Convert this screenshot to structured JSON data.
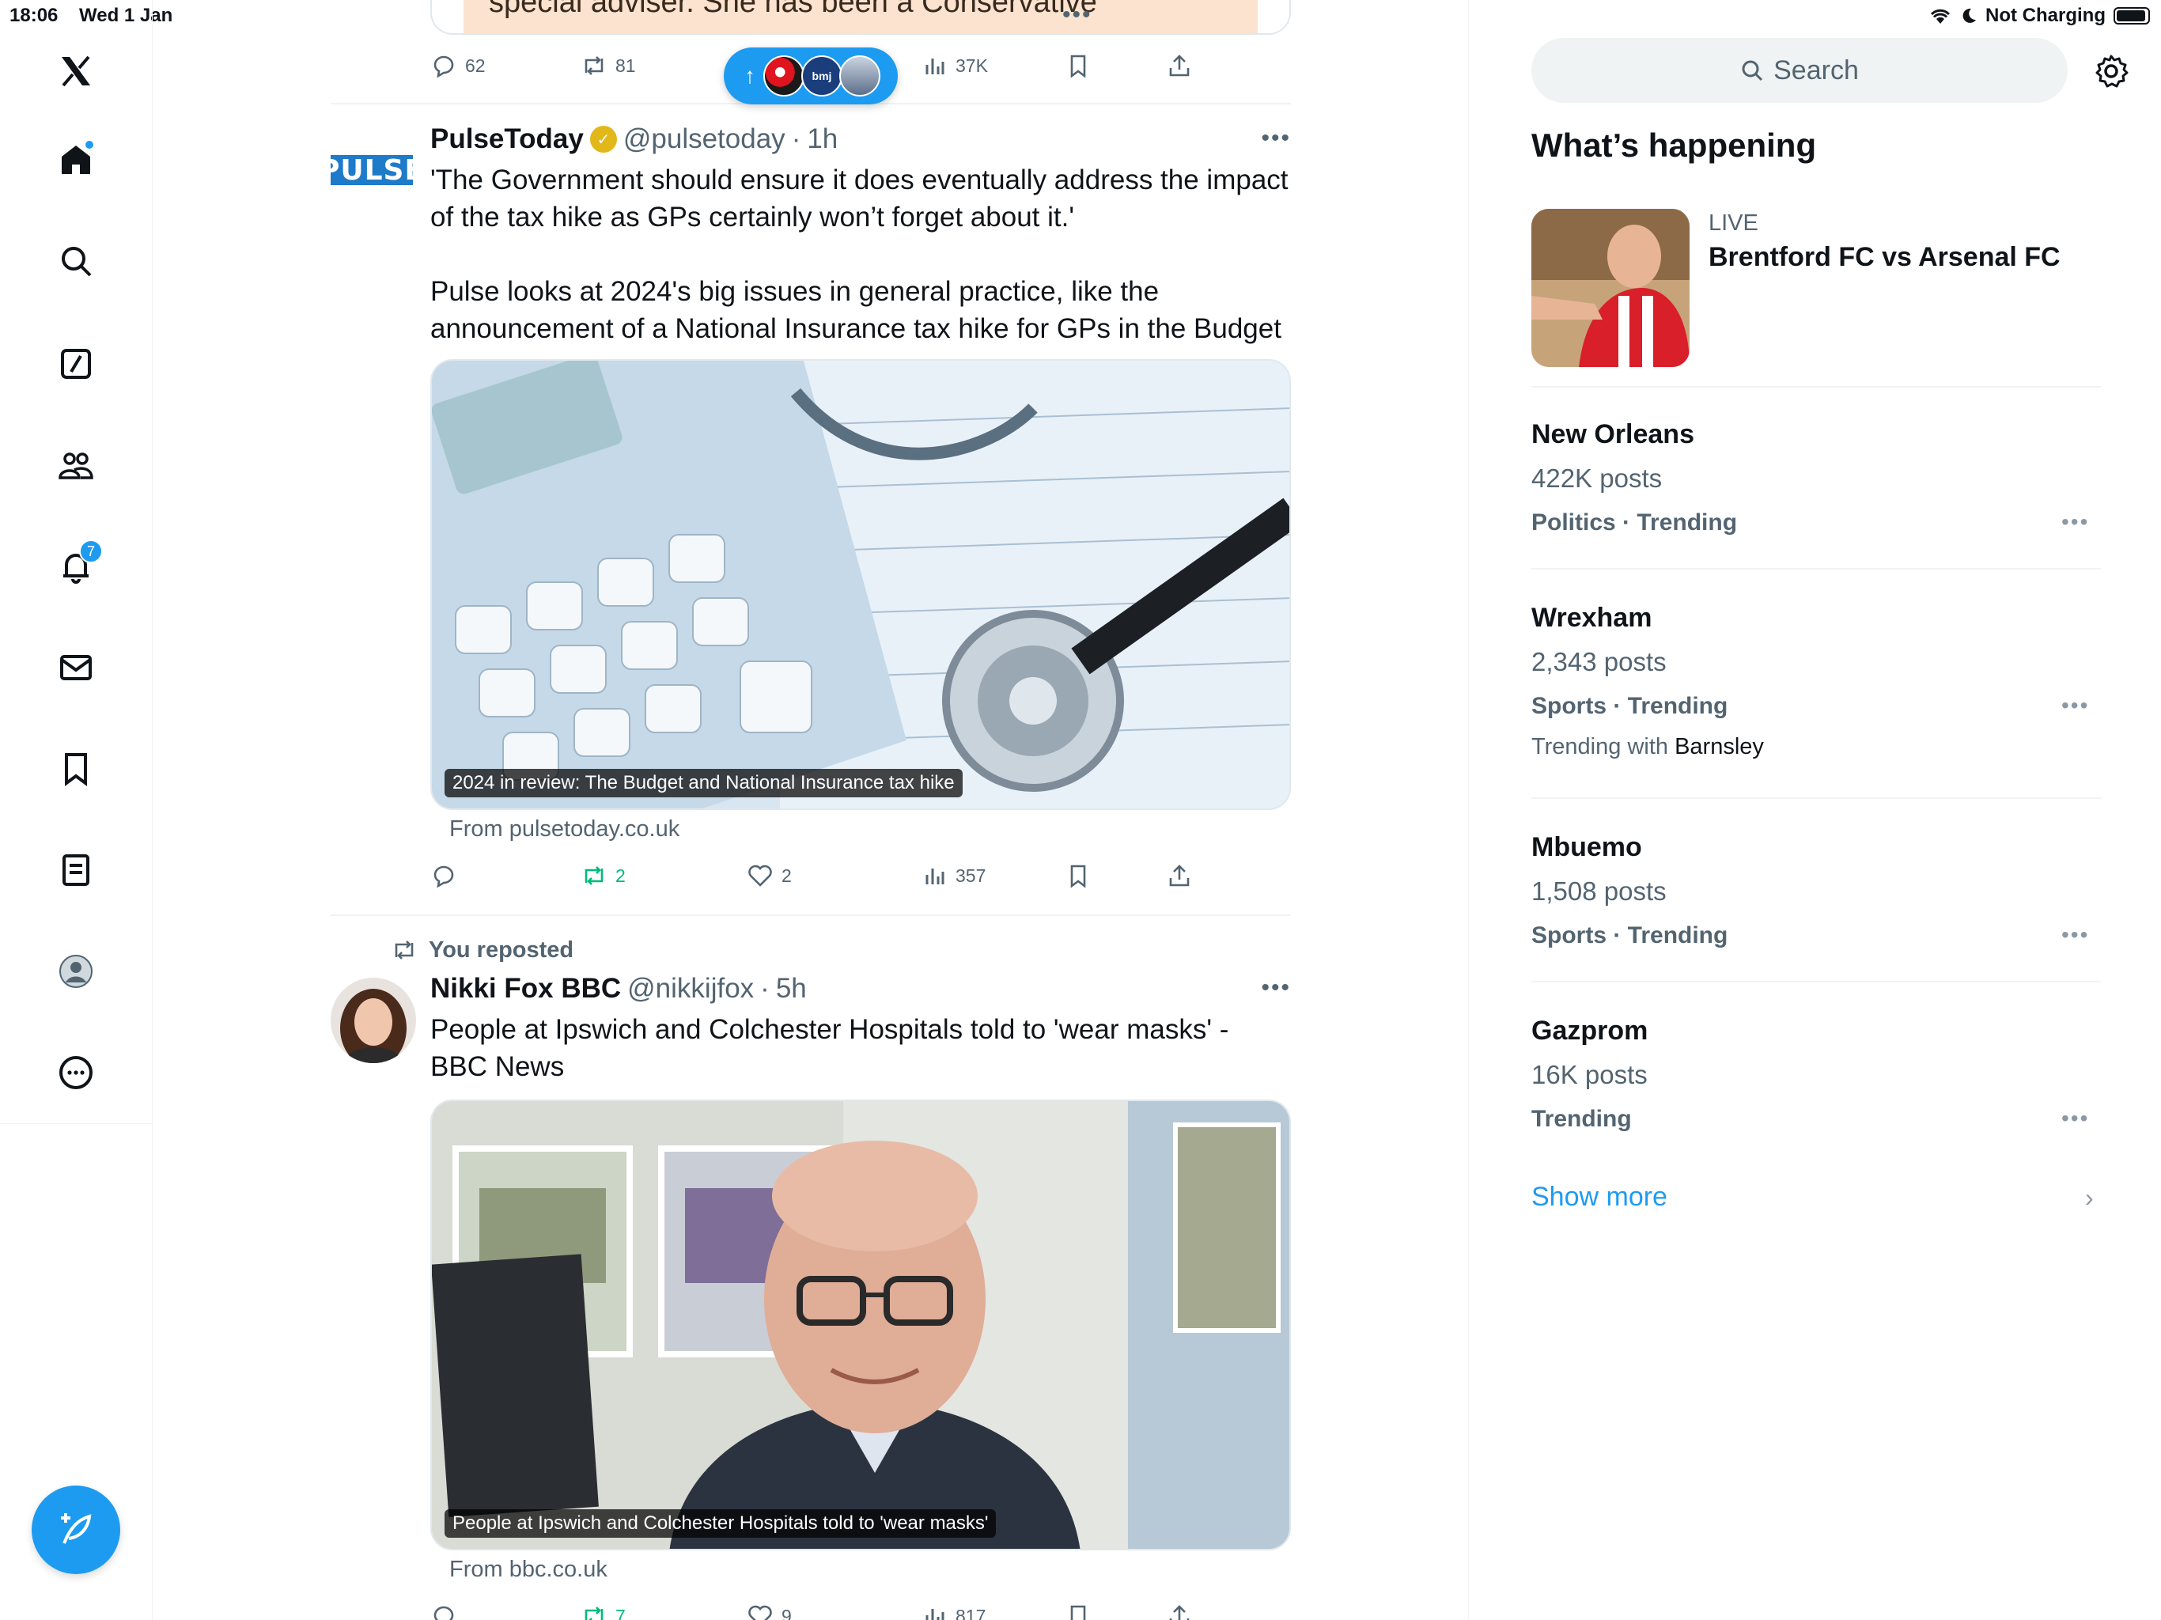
{
  "status": {
    "time": "18:06",
    "date": "Wed 1 Jan",
    "charging": "Not Charging"
  },
  "nav": {
    "items": [
      "home",
      "explore",
      "grok",
      "communities",
      "notifications",
      "messages",
      "bookmarks",
      "lists",
      "profile",
      "more"
    ],
    "notification_count": "7"
  },
  "prev_tweet": {
    "card_text": "special adviser. She has been a Conservative",
    "actions": {
      "reply": "62",
      "repost": "81",
      "views": "37K"
    }
  },
  "new_posts_pill": {
    "label": "bmj"
  },
  "tweet1": {
    "name": "PulseToday",
    "handle": "@pulsetoday",
    "time": "1h",
    "logo_text": "PULSE",
    "text": "'The Government should ensure it does eventually address the impact of the tax hike as GPs certainly won’t forget about it.'\n\nPulse looks at 2024's big issues in general practice, like the announcement of a National Insurance tax hike for GPs in the Budget",
    "media_caption": "2024 in review: The Budget and National Insurance tax hike",
    "from": "From pulsetoday.co.uk",
    "actions": {
      "reply": "",
      "repost": "2",
      "like": "2",
      "views": "357"
    }
  },
  "tweet2": {
    "repost_label": "You reposted",
    "name": "Nikki Fox BBC",
    "handle": "@nikkijfox",
    "time": "5h",
    "text": "People at Ipswich and Colchester Hospitals told to 'wear masks' - BBC News",
    "media_caption": "People at Ipswich and Colchester Hospitals told to 'wear masks'",
    "from": "From bbc.co.uk",
    "actions": {
      "reply": "",
      "repost": "7",
      "like": "9",
      "views": "817"
    }
  },
  "right": {
    "search_placeholder": "Search",
    "section_title": "What’s happening",
    "live": {
      "label": "LIVE",
      "title": "Brentford FC vs Arsenal FC"
    },
    "trends": [
      {
        "name": "New Orleans",
        "posts": "422K posts",
        "category": "Politics · Trending",
        "with_label": "",
        "with_value": ""
      },
      {
        "name": "Wrexham",
        "posts": "2,343 posts",
        "category": "Sports · Trending",
        "with_label": "Trending with",
        "with_value": "Barnsley"
      },
      {
        "name": "Mbuemo",
        "posts": "1,508 posts",
        "category": "Sports · Trending",
        "with_label": "",
        "with_value": ""
      },
      {
        "name": "Gazprom",
        "posts": "16K posts",
        "category": "Trending",
        "with_label": "",
        "with_value": ""
      }
    ],
    "show_more": "Show more"
  },
  "colors": {
    "accent": "#1d9bf0",
    "repost_green": "#00ba7c",
    "secondary_text": "#536471",
    "verified_gold": "#e2b719"
  }
}
